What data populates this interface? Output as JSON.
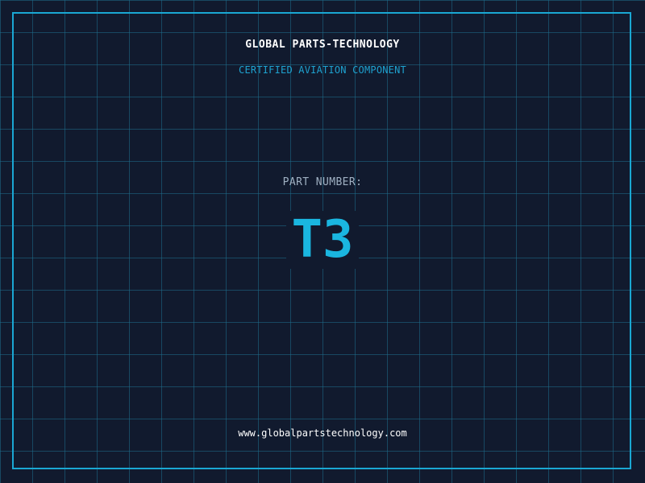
{
  "header": {
    "company": "GLOBAL PARTS-TECHNOLOGY",
    "subtitle": "CERTIFIED AVIATION COMPONENT"
  },
  "part": {
    "label": "PART NUMBER:",
    "value": "T3"
  },
  "footer": {
    "website": "www.globalpartstechnology.com"
  },
  "colors": {
    "background": "#111a2e",
    "grid": "#1e6e8c",
    "frame": "#1aa7d3",
    "accent": "#1ab6e0",
    "label": "#9fb0c2",
    "text": "#ffffff"
  }
}
